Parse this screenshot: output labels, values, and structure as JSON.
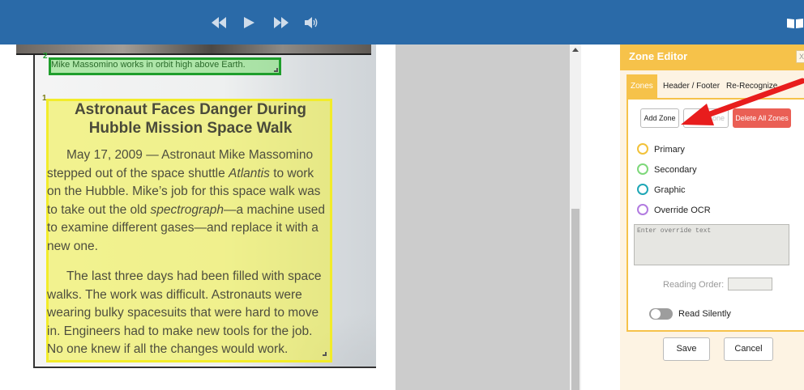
{
  "colors": {
    "topbar": "#2a6aa8",
    "primary_zone": "#f2c23a",
    "secondary_zone": "#7ed87a",
    "graphic_zone": "#1fa7b6",
    "override_zone": "#b27be0",
    "editor_accent": "#f6c24a",
    "danger": "#ea5f55",
    "annotation_arrow": "#e81d1d"
  },
  "toolbar": {
    "icons": [
      "rewind-icon",
      "play-icon",
      "fast-forward-icon",
      "volume-icon",
      "book-icon"
    ]
  },
  "document": {
    "zone_green_number": "2",
    "zone_yellow_number": "1",
    "caption": "Mike Massomino works in orbit high above Earth.",
    "headline_line1": "Astronaut Faces Danger During",
    "headline_line2": "Hubble Mission Space Walk",
    "para1": {
      "text1": "May 17, 2009 — Astronaut Mike Massomino stepped out of the space shuttle ",
      "italic1": "Atlantis",
      "text2": " to work on the Hubble. Mike’s job for this space walk was to take out the old ",
      "italic2": "spectrograph",
      "text3": "—a machine used to examine different gases—and replace it with a new one."
    },
    "para2": "The last three days had been filled with space walks. The work was difficult. Astronauts were wearing bulky spacesuits that were hard to move in. Engineers had to make new tools for the job. No one knew if all the changes would work."
  },
  "zone_editor": {
    "title": "Zone Editor",
    "close_label": "X",
    "tabs": [
      "Zones",
      "Header / Footer",
      "Re-Recognize"
    ],
    "active_tab": "Zones",
    "add_zone_label": "Add Zone",
    "delete_zone_label": "Zone",
    "delete_all_label": "Delete All Zones",
    "zone_types": [
      "Primary",
      "Secondary",
      "Graphic",
      "Override OCR"
    ],
    "override_placeholder": "Enter override text",
    "reading_order_label": "Reading Order:",
    "reading_order_value": "",
    "read_silently_label": "Read Silently",
    "read_silently_on": false,
    "save_label": "Save",
    "cancel_label": "Cancel"
  }
}
